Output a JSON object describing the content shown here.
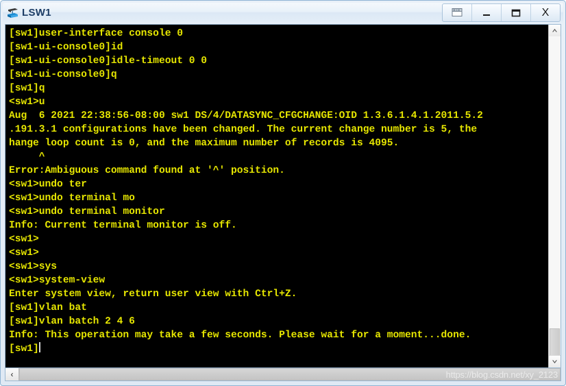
{
  "window": {
    "title": "LSW1",
    "icon": "switch-device-icon",
    "controls": [
      {
        "name": "restore-down-button",
        "glyph": "restore"
      },
      {
        "name": "minimize-button",
        "glyph": "minimize"
      },
      {
        "name": "maximize-button",
        "glyph": "maximize"
      },
      {
        "name": "close-button",
        "glyph": "X"
      }
    ]
  },
  "terminal": {
    "foreground_color": "#e6e600",
    "background_color": "#000000",
    "lines": [
      "[sw1]user-interface console 0",
      "[sw1-ui-console0]id",
      "[sw1-ui-console0]idle-timeout 0 0",
      "[sw1-ui-console0]q",
      "[sw1]q",
      "<sw1>u",
      "Aug  6 2021 22:38:56-08:00 sw1 DS/4/DATASYNC_CFGCHANGE:OID 1.3.6.1.4.1.2011.5.2",
      ".191.3.1 configurations have been changed. The current change number is 5, the ",
      "hange loop count is 0, and the maximum number of records is 4095.",
      "     ^",
      "Error:Ambiguous command found at '^' position.",
      "<sw1>undo ter",
      "<sw1>undo terminal mo",
      "<sw1>undo terminal monitor",
      "Info: Current terminal monitor is off.",
      "<sw1>",
      "<sw1>",
      "<sw1>sys",
      "<sw1>system-view",
      "Enter system view, return user view with Ctrl+Z.",
      "[sw1]vlan bat",
      "[sw1]vlan batch 2 4 6",
      "Info: This operation may take a few seconds. Please wait for a moment...done.",
      "[sw1]"
    ],
    "cursor_line_index": 23,
    "cursor_visible": true
  },
  "scrollbars": {
    "vertical": {
      "up_arrow": "▲",
      "down_arrow": "▼",
      "thumb_position": "bottom"
    },
    "horizontal": {
      "left_arrow": "‹",
      "right_arrow": "›"
    }
  },
  "watermark": {
    "text": "https://blog.csdn.net/xy_2123"
  }
}
